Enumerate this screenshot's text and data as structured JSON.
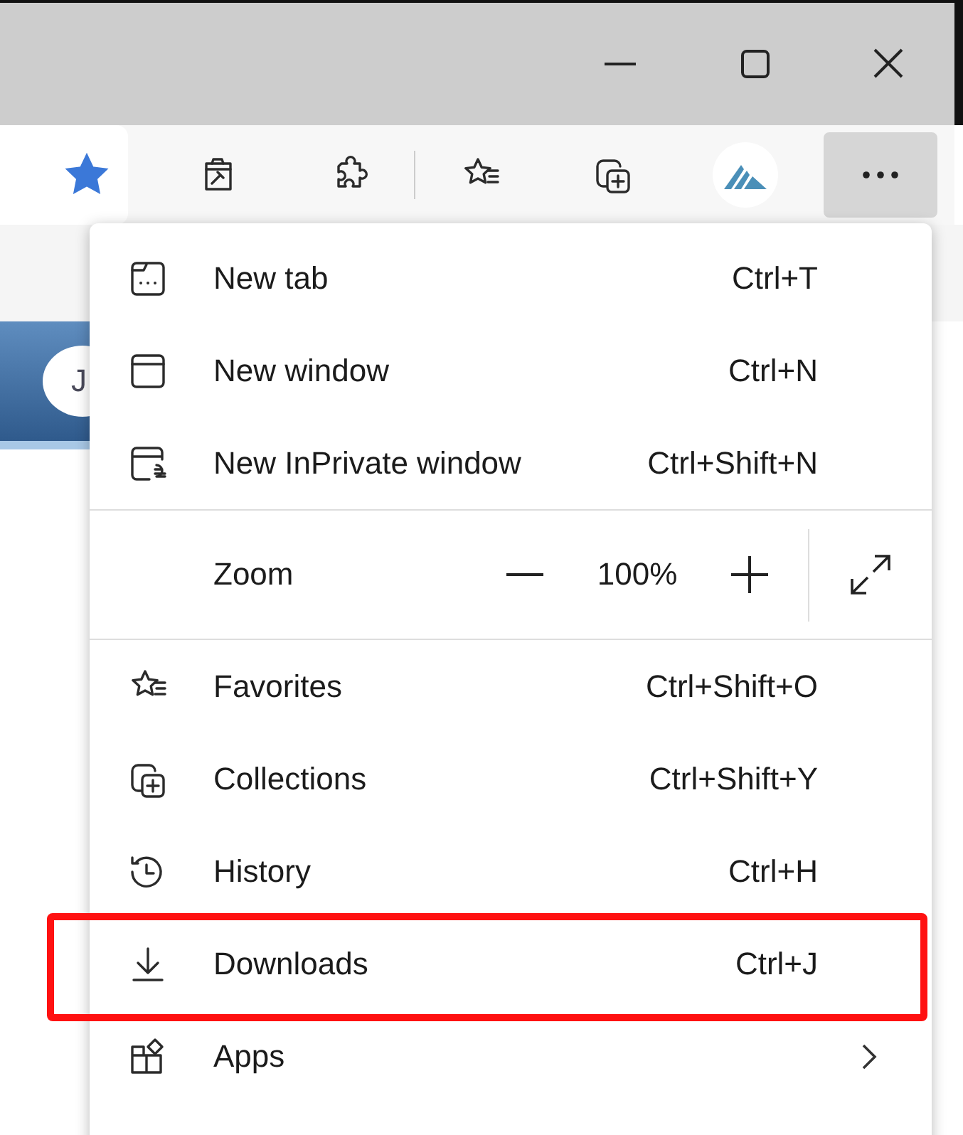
{
  "window": {
    "controls": [
      {
        "kind": "minimize"
      },
      {
        "kind": "maximize"
      },
      {
        "kind": "close"
      }
    ]
  },
  "toolbar": {
    "favorited": true,
    "buttons": [
      {
        "kind": "tool"
      },
      {
        "kind": "puzzle"
      },
      {
        "kind": "divider"
      },
      {
        "kind": "favorites"
      },
      {
        "kind": "collections"
      },
      {
        "kind": "profile"
      }
    ],
    "more_button": {
      "active": true
    }
  },
  "page": {
    "banner": {
      "avatar_letter": "J"
    }
  },
  "menu": {
    "items": [
      {
        "kind": "item",
        "label": "New tab",
        "shortcut": "Ctrl+T",
        "annotated": false
      },
      {
        "kind": "item",
        "label": "New window",
        "shortcut": "Ctrl+N",
        "annotated": false
      },
      {
        "kind": "item",
        "label": "New InPrivate window",
        "shortcut": "Ctrl+Shift+N",
        "annotated": false
      },
      {
        "kind": "separator"
      },
      {
        "kind": "zoom",
        "label": "Zoom",
        "value": "100%"
      },
      {
        "kind": "separator"
      },
      {
        "kind": "item",
        "label": "Favorites",
        "shortcut": "Ctrl+Shift+O",
        "annotated": false
      },
      {
        "kind": "item",
        "label": "Collections",
        "shortcut": "Ctrl+Shift+Y",
        "annotated": false
      },
      {
        "kind": "item",
        "label": "History",
        "shortcut": "Ctrl+H",
        "annotated": false
      },
      {
        "kind": "item",
        "label": "Downloads",
        "shortcut": "Ctrl+J",
        "annotated": true
      },
      {
        "kind": "item",
        "label": "Apps",
        "submenu": true,
        "annotated": false
      }
    ]
  }
}
